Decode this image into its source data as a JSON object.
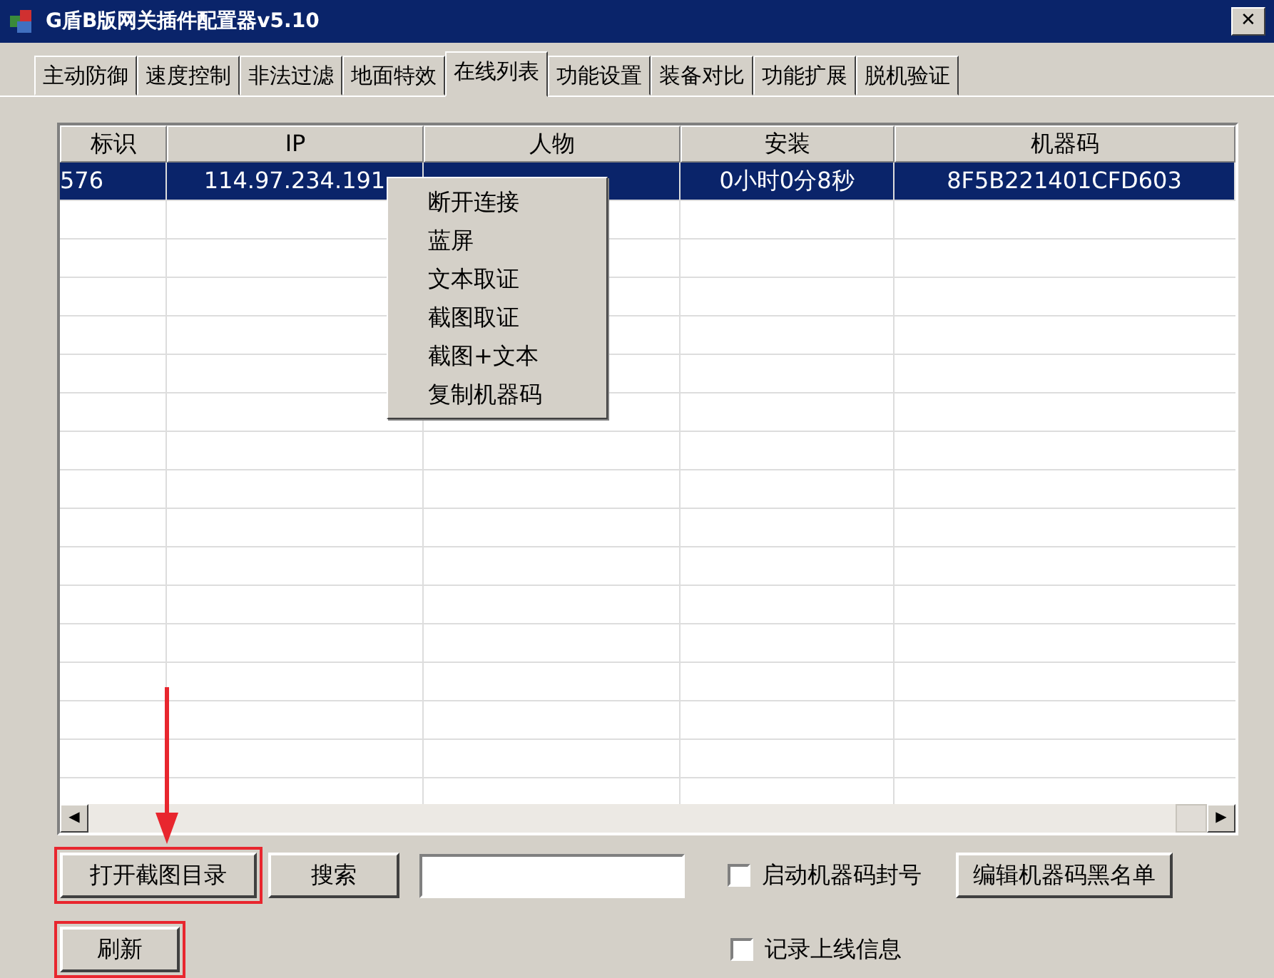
{
  "window": {
    "title": "G盾B版网关插件配置器v5.10",
    "close": "✕"
  },
  "tabs": [
    {
      "label": "主动防御",
      "selected": false
    },
    {
      "label": "速度控制",
      "selected": false
    },
    {
      "label": "非法过滤",
      "selected": false
    },
    {
      "label": "地面特效",
      "selected": false
    },
    {
      "label": "在线列表",
      "selected": true
    },
    {
      "label": "功能设置",
      "selected": false
    },
    {
      "label": "装备对比",
      "selected": false
    },
    {
      "label": "功能扩展",
      "selected": false
    },
    {
      "label": "脱机验证",
      "selected": false
    }
  ],
  "table": {
    "columns": [
      "标识",
      "IP",
      "人物",
      "安装",
      "机器码"
    ],
    "rows": [
      {
        "cells": [
          "576",
          "114.97.234.191",
          "",
          "0小时0分8秒",
          "8F5B221401CFD603"
        ],
        "selected": true
      }
    ]
  },
  "context_menu": [
    "断开连接",
    "蓝屏",
    "文本取证",
    "截图取证",
    "截图+文本",
    "复制机器码"
  ],
  "scrollbar": {
    "left": "◀",
    "right": "▶"
  },
  "controls": [
    {
      "kind": "button",
      "label": "打开截图目录",
      "highlighted": true
    },
    {
      "kind": "button",
      "label": "搜索",
      "highlighted": false
    },
    {
      "kind": "field"
    },
    {
      "kind": "checkbox",
      "label": "启动机器码封号",
      "checked": false
    },
    {
      "kind": "button",
      "label": "编辑机器码黑名单",
      "highlighted": false
    },
    {
      "kind": "newline"
    },
    {
      "kind": "button",
      "label": "刷新",
      "highlighted": true
    },
    {
      "kind": "checkbox",
      "label": "记录上线信息",
      "checked": false
    }
  ]
}
